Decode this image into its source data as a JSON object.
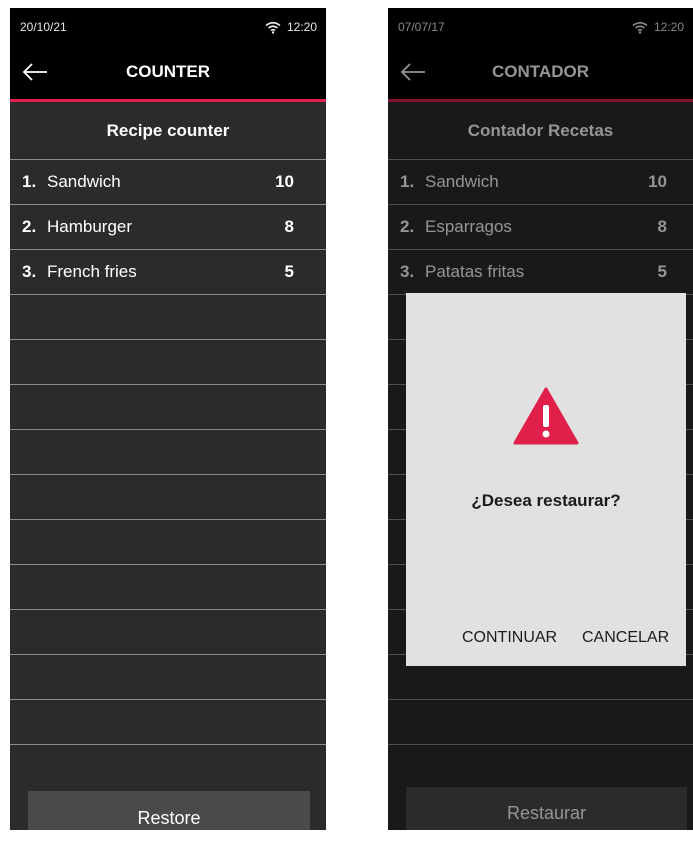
{
  "left_screen": {
    "status": {
      "date": "20/10/21",
      "time": "12:20"
    },
    "header": {
      "title": "COUNTER"
    },
    "list_title": "Recipe counter",
    "items": [
      {
        "index": "1.",
        "name": "Sandwich",
        "count": "10"
      },
      {
        "index": "2.",
        "name": "Hamburger",
        "count": "8"
      },
      {
        "index": "3.",
        "name": "French fries",
        "count": "5"
      }
    ],
    "restore_label": "Restore"
  },
  "right_screen": {
    "status": {
      "date": "07/07/17",
      "time": "12:20"
    },
    "header": {
      "title": "CONTADOR"
    },
    "list_title": "Contador Recetas",
    "items": [
      {
        "index": "1.",
        "name": "Sandwich",
        "count": "10"
      },
      {
        "index": "2.",
        "name": "Esparragos",
        "count": "8"
      },
      {
        "index": "3.",
        "name": "Patatas fritas",
        "count": "5"
      }
    ],
    "restore_label": "Restaurar",
    "dialog": {
      "message": "¿Desea restaurar?",
      "continue_label": "CONTINUAR",
      "cancel_label": "CANCELAR"
    }
  },
  "colors": {
    "accent": "#e0204a",
    "background": "#2b2b2b",
    "divider": "#8a8a8a",
    "dialog_bg": "#e1e1e1"
  },
  "icons": [
    "wifi-icon",
    "back-arrow-icon",
    "warning-icon"
  ]
}
